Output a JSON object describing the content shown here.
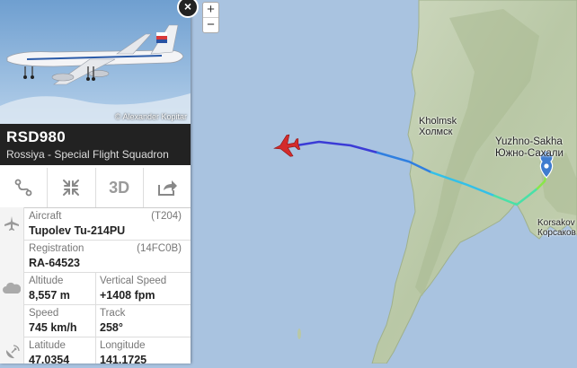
{
  "map": {
    "zoom_in": "+",
    "zoom_out": "−",
    "labels": {
      "kholmsk_en": "Kholmsk",
      "kholmsk_ru": "Холмск",
      "yuzhno_en": "Yuzhno-Sakha",
      "yuzhno_ru": "Южно-Сахали",
      "korsakov_en": "Korsakov",
      "korsakov_ru": "Корсаков"
    },
    "track_colors": [
      "#3b3bd6",
      "#2f7fe0",
      "#33c0e8",
      "#49e0a8",
      "#8ae64a"
    ]
  },
  "photo": {
    "credit": "© Alexander Kopitar"
  },
  "flight": {
    "callsign": "RSD980",
    "airline": "Rossiya - Special Flight Squadron"
  },
  "toolbar": {
    "route_icon": "route-icon",
    "fit_icon": "collapse-arrows-icon",
    "three_d_label": "3D",
    "share_icon": "share-icon"
  },
  "details": {
    "aircraft_label": "Aircraft",
    "aircraft_code": "(T204)",
    "aircraft_value": "Tupolev Tu-214PU",
    "registration_label": "Registration",
    "registration_code": "(14FC0B)",
    "registration_value": "RA-64523",
    "altitude_label": "Altitude",
    "altitude_value": "8,557 m",
    "vspeed_label": "Vertical Speed",
    "vspeed_value": "+1408 fpm",
    "speed_label": "Speed",
    "speed_value": "745 km/h",
    "track_label": "Track",
    "track_value": "258°",
    "latitude_label": "Latitude",
    "latitude_value": "47.0354",
    "longitude_label": "Longitude",
    "longitude_value": "141.1725"
  }
}
